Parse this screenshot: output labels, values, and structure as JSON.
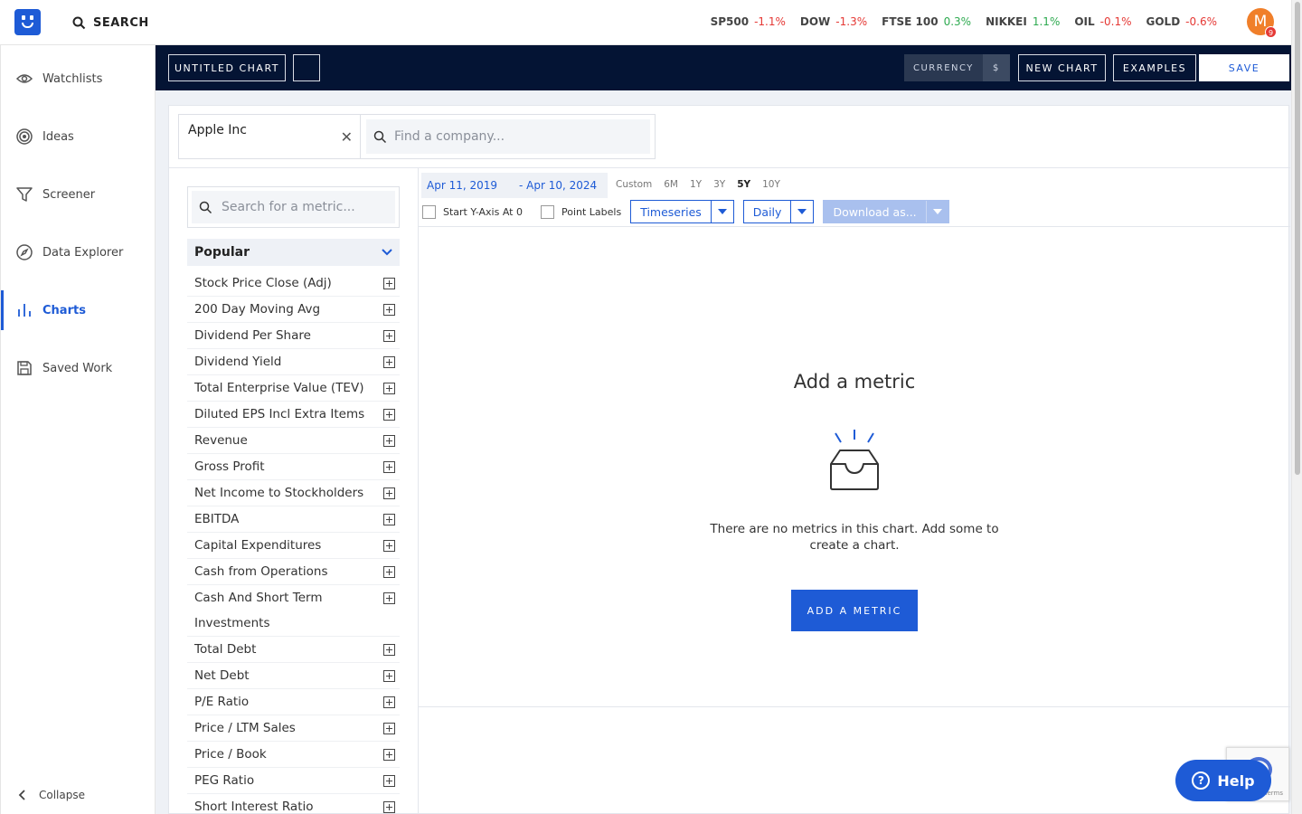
{
  "topbar": {
    "search_label": "SEARCH",
    "tickers": [
      {
        "name": "SP500",
        "change": "-1.1%",
        "dir": "neg"
      },
      {
        "name": "DOW",
        "change": "-1.3%",
        "dir": "neg"
      },
      {
        "name": "FTSE 100",
        "change": "0.3%",
        "dir": "pos"
      },
      {
        "name": "NIKKEI",
        "change": "1.1%",
        "dir": "pos"
      },
      {
        "name": "OIL",
        "change": "-0.1%",
        "dir": "neg"
      },
      {
        "name": "GOLD",
        "change": "-0.6%",
        "dir": "neg"
      }
    ],
    "avatar_initial": "M",
    "notification_count": "9"
  },
  "sidebar": {
    "items": [
      {
        "label": "Watchlists",
        "icon": "eye-icon"
      },
      {
        "label": "Ideas",
        "icon": "target-icon"
      },
      {
        "label": "Screener",
        "icon": "filter-icon"
      },
      {
        "label": "Data Explorer",
        "icon": "compass-icon"
      },
      {
        "label": "Charts",
        "icon": "bar-chart-icon",
        "active": true
      },
      {
        "label": "Saved Work",
        "icon": "save-icon"
      }
    ],
    "collapse_label": "Collapse"
  },
  "toolbar": {
    "chart_title": "UNTITLED CHART",
    "currency_label": "CURRENCY",
    "currency_value": "$",
    "new_chart_label": "NEW CHART",
    "examples_label": "EXAMPLES",
    "save_label": "SAVE"
  },
  "company": {
    "selected": "Apple Inc",
    "find_placeholder": "Find a company..."
  },
  "metrics": {
    "search_placeholder": "Search for a metric...",
    "category": "Popular",
    "items": [
      "Stock Price Close (Adj)",
      "200 Day Moving Avg",
      "Dividend Per Share",
      "Dividend Yield",
      "Total Enterprise Value (TEV)",
      "Diluted EPS Incl Extra Items",
      "Revenue",
      "Gross Profit",
      "Net Income to Stockholders",
      "EBITDA",
      "Capital Expenditures",
      "Cash from Operations",
      "Cash And Short Term Investments",
      "Total Debt",
      "Net Debt",
      "P/E Ratio",
      "Price / LTM Sales",
      "Price / Book",
      "PEG Ratio",
      "Short Interest Ratio"
    ]
  },
  "chart": {
    "date_from": "Apr 11, 2019",
    "date_to": "- Apr 10, 2024",
    "ranges": [
      "Custom",
      "6M",
      "1Y",
      "3Y",
      "5Y",
      "10Y"
    ],
    "selected_range": "5Y",
    "start_y_axis_label": "Start Y-Axis At 0",
    "point_labels_label": "Point Labels",
    "chart_type": "Timeseries",
    "frequency": "Daily",
    "download_label": "Download as...",
    "empty_title": "Add a metric",
    "empty_text": "There are no metrics in this chart. Add some to create a chart.",
    "add_metric_label": "ADD A METRIC"
  },
  "help_label": "Help",
  "recaptcha_text": "Terms"
}
